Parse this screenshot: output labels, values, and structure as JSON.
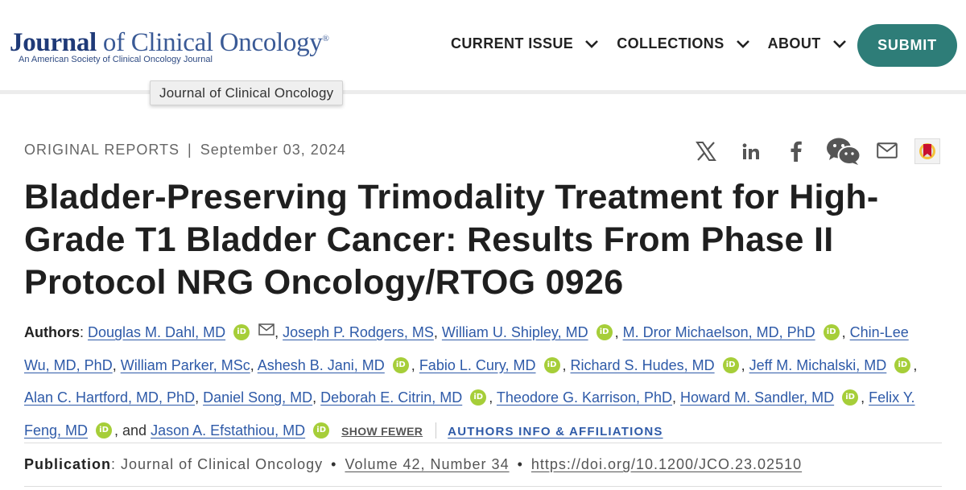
{
  "header": {
    "logo_word": "Journal",
    "logo_rest": " of Clinical Oncology",
    "logo_reg": "®",
    "logo_subtitle": "An American Society of Clinical Oncology Journal",
    "nav": [
      {
        "label": "CURRENT ISSUE"
      },
      {
        "label": "COLLECTIONS"
      },
      {
        "label": "ABOUT"
      }
    ],
    "submit_label": "SUBMIT"
  },
  "tooltip": "Journal of Clinical Oncology",
  "meta": {
    "section": "ORIGINAL REPORTS",
    "separator": "|",
    "date": "September 03, 2024"
  },
  "share_icons": [
    "x-icon",
    "linkedin-icon",
    "facebook-icon",
    "wechat-icon",
    "email-icon",
    "mendeley-icon"
  ],
  "title": "Bladder-Preserving Trimodality Treatment for High-Grade T1 Bladder Cancer: Results From Phase II Protocol NRG Oncology/RTOG 0926",
  "authors": {
    "label": "Authors",
    "colon": ": ",
    "list": [
      "Douglas M. Dahl, MD",
      "Joseph P. Rodgers, MS",
      "William U. Shipley, MD",
      "M. Dror Michaelson, MD, PhD",
      "Chin-Lee Wu, MD, PhD",
      "William Parker, MSc",
      "Ashesh B. Jani, MD",
      "Fabio L. Cury, MD",
      "Richard S. Hudes, MD",
      "Jeff M. Michalski, MD",
      "Alan C. Hartford, MD, PhD",
      "Daniel Song, MD",
      "Deborah E. Citrin, MD",
      "Theodore G. Karrison, PhD",
      "Howard M. Sandler, MD",
      "Felix Y. Feng, MD",
      "Jason A. Efstathiou, MD"
    ],
    "orcid_text": "iD",
    "and_text": ", and ",
    "show_fewer": "SHOW FEWER",
    "affiliations": "AUTHORS INFO & AFFILIATIONS"
  },
  "publication": {
    "label": "Publication",
    "journal": "Journal of Clinical Oncology",
    "volume": "Volume 42, Number 34",
    "doi": "https://doi.org/10.1200/JCO.23.02510"
  },
  "colors": {
    "brand_teal": "#2e7d78",
    "link_blue": "#2e5aa8",
    "orcid_green": "#a6ce39"
  }
}
